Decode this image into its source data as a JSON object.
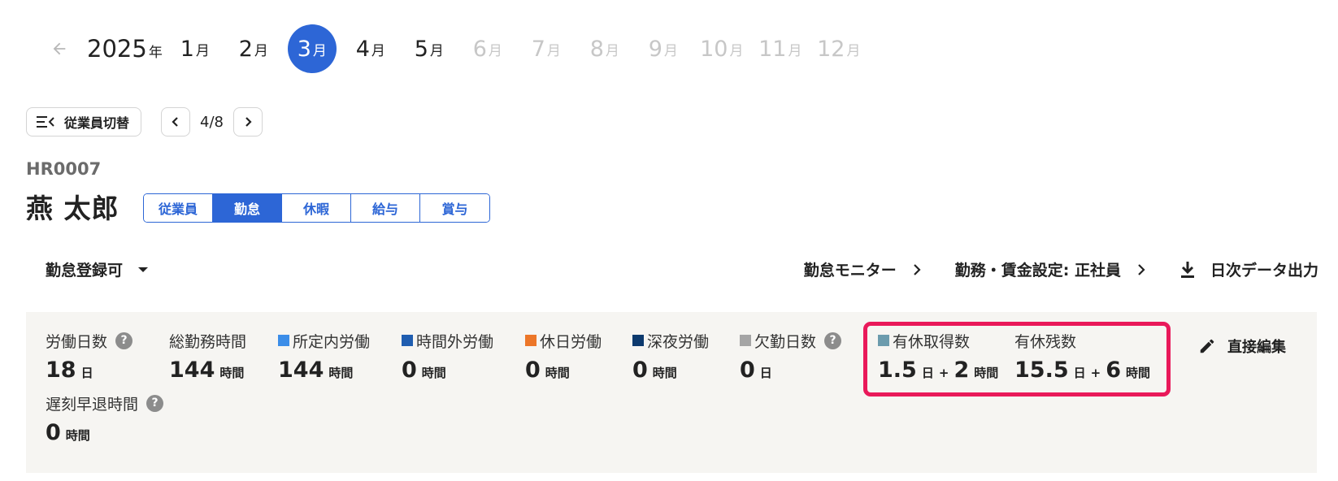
{
  "year_nav": {
    "back_icon": "arrow-left-icon",
    "year": "2025",
    "year_suffix": "年",
    "month_suffix": "月",
    "months": [
      {
        "label": "1",
        "state": "enabled"
      },
      {
        "label": "2",
        "state": "enabled"
      },
      {
        "label": "3",
        "state": "active"
      },
      {
        "label": "4",
        "state": "enabled"
      },
      {
        "label": "5",
        "state": "enabled"
      },
      {
        "label": "6",
        "state": "disabled"
      },
      {
        "label": "7",
        "state": "disabled"
      },
      {
        "label": "8",
        "state": "disabled"
      },
      {
        "label": "9",
        "state": "disabled"
      },
      {
        "label": "10",
        "state": "disabled"
      },
      {
        "label": "11",
        "state": "disabled"
      },
      {
        "label": "12",
        "state": "disabled"
      }
    ]
  },
  "employee_switch": {
    "button_label": "従業員切替",
    "icon": "list-collapse-icon",
    "pager": "4/8"
  },
  "employee": {
    "code": "HR0007",
    "name": "燕 太郎",
    "tabs": [
      {
        "label": "従業員",
        "active": false
      },
      {
        "label": "勤怠",
        "active": true
      },
      {
        "label": "休暇",
        "active": false
      },
      {
        "label": "給与",
        "active": false
      },
      {
        "label": "賞与",
        "active": false
      }
    ]
  },
  "actions": {
    "status_dropdown": "勤怠登録可",
    "monitor": "勤怠モニター",
    "work_settings": "勤務・賃金設定: 正社員",
    "export": "日次データ出力"
  },
  "stats": {
    "work_days": {
      "label": "労働日数",
      "value": "18",
      "unit": "日"
    },
    "total_hours": {
      "label": "総勤務時間",
      "value": "144",
      "unit": "時間"
    },
    "scheduled": {
      "label": "所定内労働",
      "value": "144",
      "unit": "時間",
      "color": "#3b8de8"
    },
    "overtime": {
      "label": "時間外労働",
      "value": "0",
      "unit": "時間",
      "color": "#1f5db0"
    },
    "holiday": {
      "label": "休日労働",
      "value": "0",
      "unit": "時間",
      "color": "#ec7628"
    },
    "night": {
      "label": "深夜労働",
      "value": "0",
      "unit": "時間",
      "color": "#0d3a6e"
    },
    "absence": {
      "label": "欠勤日数",
      "value": "0",
      "unit": "日",
      "color": "#a5a5a5"
    },
    "paid_leave_taken": {
      "label": "有休取得数",
      "days": "1.5",
      "days_unit": "日",
      "plus": "+",
      "hours": "2",
      "hours_unit": "時間",
      "color": "#6b9bad"
    },
    "paid_leave_remaining": {
      "label": "有休残数",
      "days": "15.5",
      "days_unit": "日",
      "plus": "+",
      "hours": "6",
      "hours_unit": "時間"
    },
    "late_early": {
      "label": "遅刻早退時間",
      "value": "0",
      "unit": "時間"
    }
  },
  "edit": {
    "label": "直接編集"
  },
  "help_glyph": "?",
  "colors": {
    "accent": "#2d66d6",
    "highlight": "#e9195a",
    "panel": "#f6f5f2"
  }
}
